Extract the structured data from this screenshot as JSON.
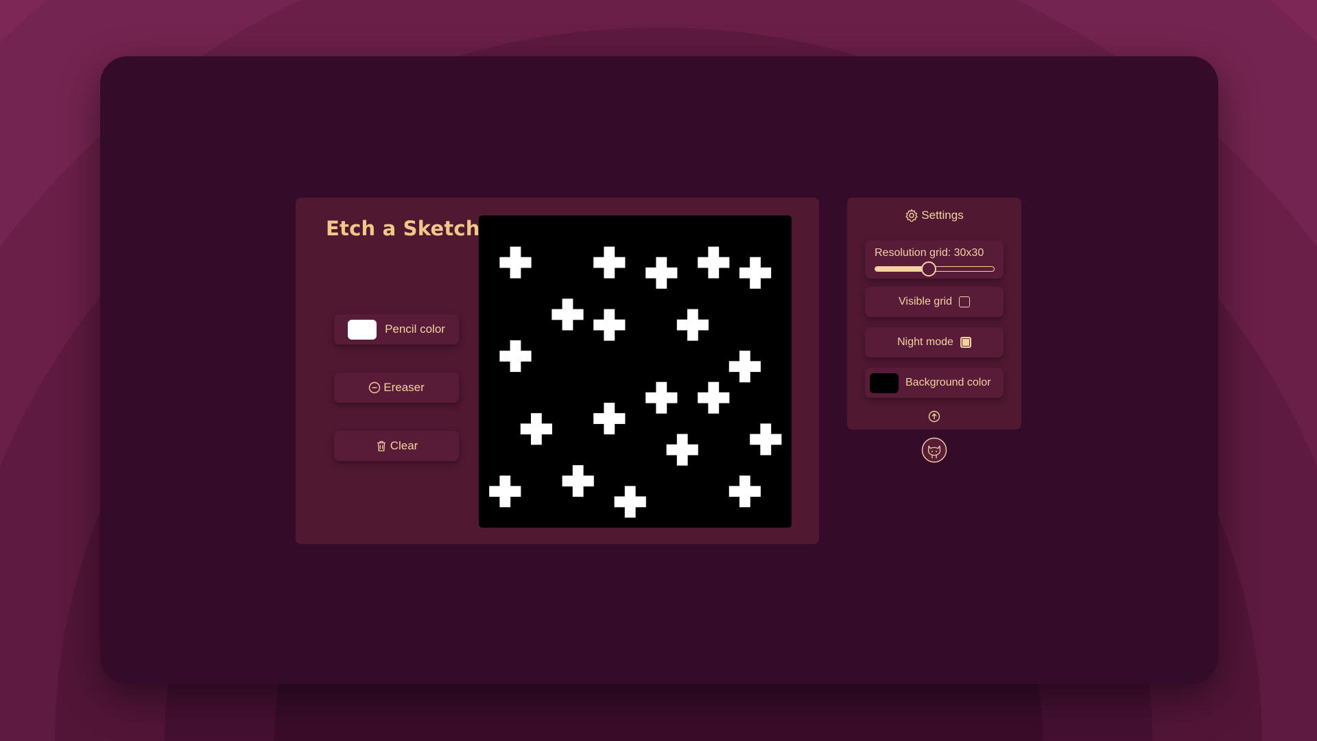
{
  "app": {
    "title": "Etch a Sketch"
  },
  "tools": {
    "pencil_label": "Pencil color",
    "pencil_color": "#ffffff",
    "eraser_label": "Ereaser",
    "clear_label": "Clear"
  },
  "canvas": {
    "background_color": "#000000",
    "pixel_color": "#ffffff",
    "grid_size": 30,
    "plus_centers": [
      [
        3,
        4
      ],
      [
        12,
        4
      ],
      [
        22,
        4
      ],
      [
        17,
        5
      ],
      [
        26,
        5
      ],
      [
        8,
        9
      ],
      [
        12,
        10
      ],
      [
        20,
        10
      ],
      [
        3,
        13
      ],
      [
        25,
        14
      ],
      [
        17,
        17
      ],
      [
        22,
        17
      ],
      [
        12,
        19
      ],
      [
        5,
        20
      ],
      [
        27,
        21
      ],
      [
        19,
        22
      ],
      [
        9,
        25
      ],
      [
        2,
        26
      ],
      [
        25,
        26
      ],
      [
        14,
        27
      ]
    ]
  },
  "settings": {
    "title": "Settings",
    "resolution_label": "Resolution grid: 30x30",
    "resolution_value": 30,
    "resolution_fraction": 0.45,
    "visible_grid_label": "Visible grid",
    "visible_grid_checked": false,
    "night_mode_label": "Night mode",
    "night_mode_checked": true,
    "background_color_label": "Background color",
    "background_color": "#000000"
  },
  "icons": {
    "settings": "gear-icon",
    "eraser": "minus-circle-icon",
    "clear": "trash-icon",
    "scroll_top": "arrow-up-circle-icon",
    "github": "github-icon"
  },
  "colors": {
    "accent": "#f3d2a0",
    "title": "#f0c98a",
    "card": "#511832",
    "button": "#581c38"
  }
}
